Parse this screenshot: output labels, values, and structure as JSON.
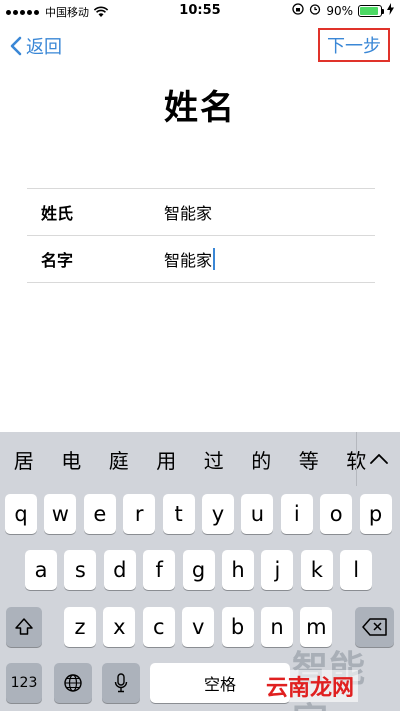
{
  "status_bar": {
    "carrier": "中国移动",
    "time": "10:55",
    "battery_percent": "90%",
    "battery_level": 0.9,
    "icons": [
      "signal-dots",
      "wifi-icon",
      "orientation-lock-icon",
      "alarm-icon",
      "battery-icon",
      "charging-icon"
    ]
  },
  "nav": {
    "back_label": "返回",
    "next_label": "下一步"
  },
  "page": {
    "title": "姓名"
  },
  "form": {
    "rows": [
      {
        "label": "姓氏",
        "value": "智能家"
      },
      {
        "label": "名字",
        "value": "智能家"
      }
    ]
  },
  "keyboard": {
    "candidates": [
      "居",
      "电",
      "庭",
      "用",
      "过",
      "的",
      "等",
      "软"
    ],
    "row1": [
      "q",
      "w",
      "e",
      "r",
      "t",
      "y",
      "u",
      "i",
      "o",
      "p"
    ],
    "row2": [
      "a",
      "s",
      "d",
      "f",
      "g",
      "h",
      "j",
      "k",
      "l"
    ],
    "row3": [
      "z",
      "x",
      "c",
      "v",
      "b",
      "n",
      "m"
    ],
    "numbers_label": "123",
    "space_label": "空格"
  },
  "watermark": {
    "text": "智能家",
    "logo": "云南龙网"
  }
}
